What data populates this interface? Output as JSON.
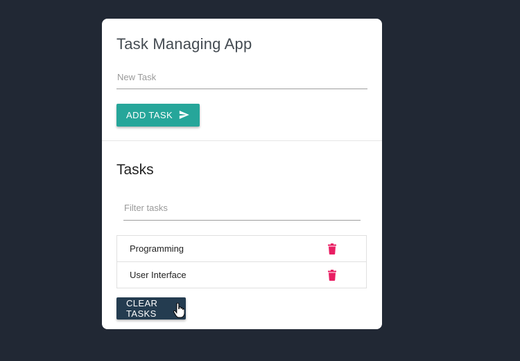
{
  "app": {
    "title": "Task Managing App"
  },
  "new_task": {
    "placeholder": "New Task",
    "value": ""
  },
  "add_button": {
    "label": "ADD TASK",
    "icon": "send-icon",
    "color": "#26a69a"
  },
  "tasks": {
    "heading": "Tasks",
    "filter_placeholder": "Filter tasks",
    "items": [
      {
        "label": "Programming",
        "icon": "trash-icon"
      },
      {
        "label": "User Interface",
        "icon": "trash-icon"
      }
    ]
  },
  "clear_button": {
    "label": "CLEAR TASKS",
    "color": "#243c50"
  },
  "colors": {
    "background": "#212834",
    "card": "#ffffff",
    "delete_icon": "#e91e63"
  }
}
